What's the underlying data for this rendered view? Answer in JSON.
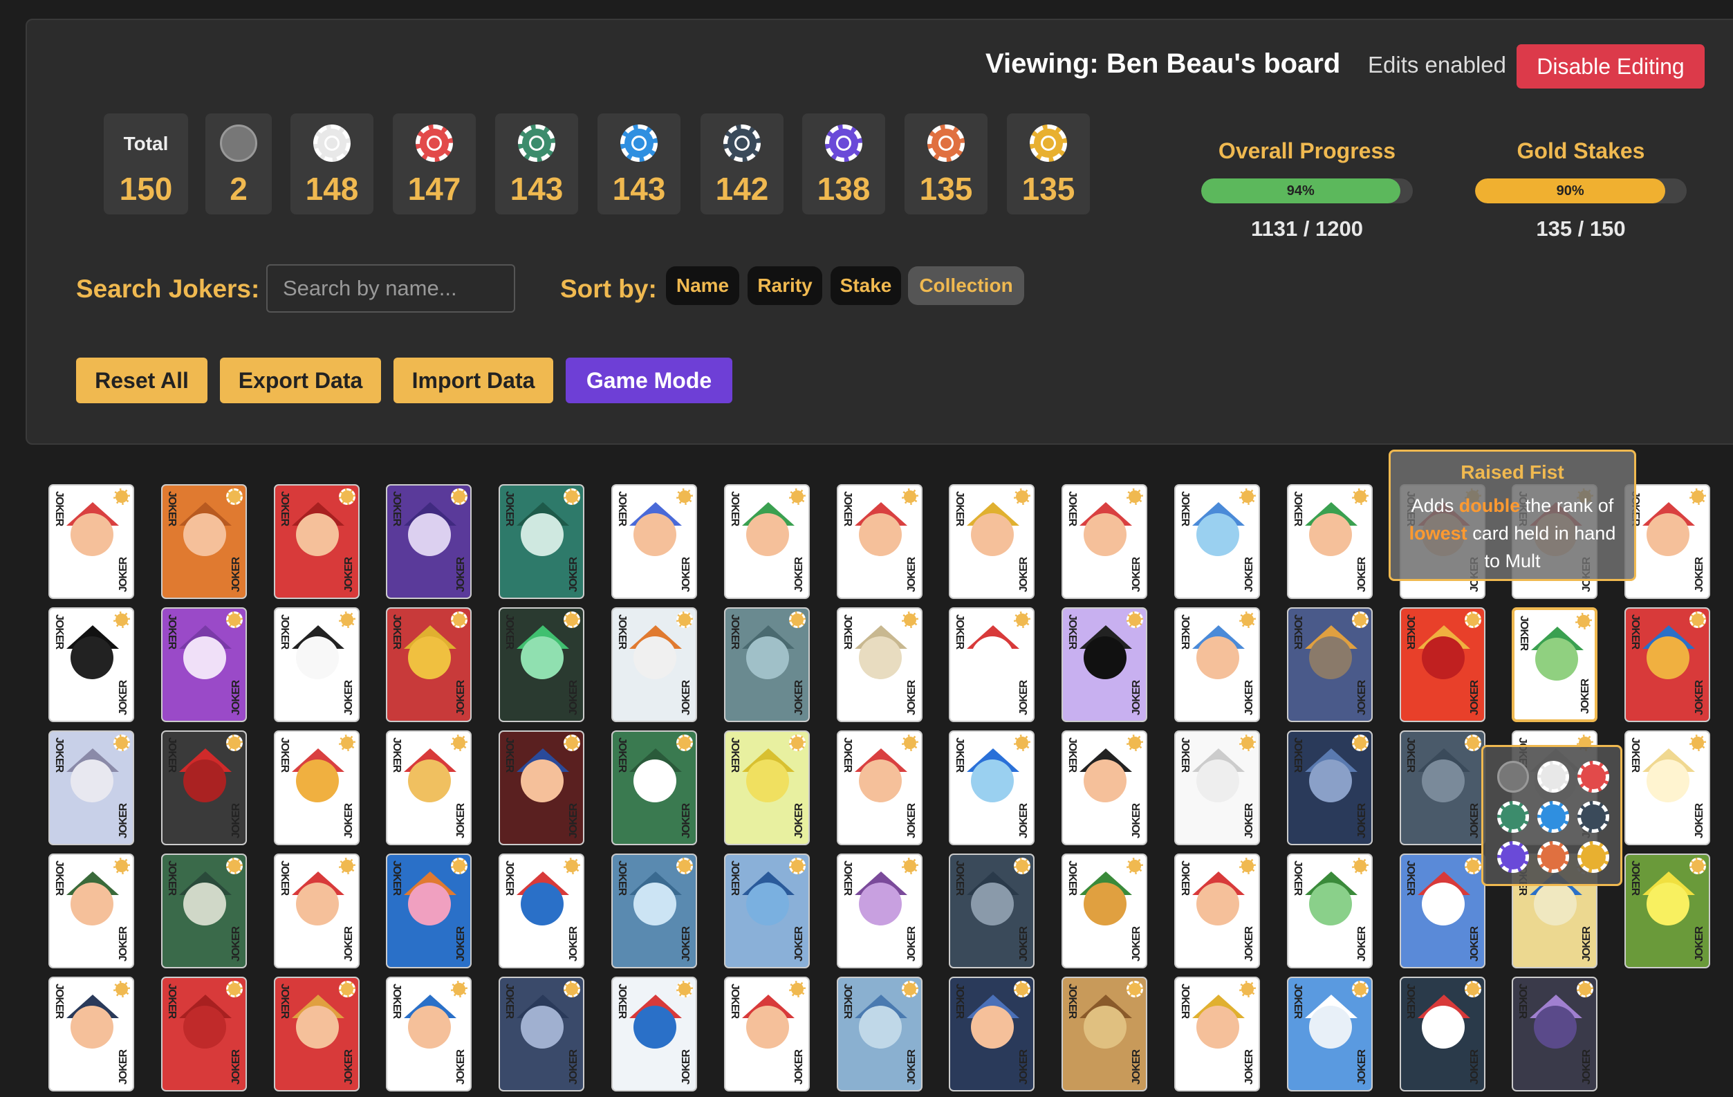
{
  "header": {
    "viewing": "Viewing: Ben Beau's board",
    "edits_status": "Edits enabled",
    "disable_button": "Disable Editing"
  },
  "stats": {
    "total_label": "Total",
    "total_value": "150",
    "stakes": [
      {
        "name": "no-stake-icon",
        "color": "#777777",
        "value": "2"
      },
      {
        "name": "white-stake-icon",
        "color": "#e8e8e8",
        "value": "148"
      },
      {
        "name": "red-stake-icon",
        "color": "#e24a4a",
        "value": "147"
      },
      {
        "name": "green-stake-icon",
        "color": "#3c8c6c",
        "value": "143"
      },
      {
        "name": "blue-stake-icon",
        "color": "#2f8fe0",
        "value": "143"
      },
      {
        "name": "black-stake-icon",
        "color": "#3a4a5a",
        "value": "142"
      },
      {
        "name": "purple-stake-icon",
        "color": "#6a4ad8",
        "value": "138"
      },
      {
        "name": "orange-stake-icon",
        "color": "#e07040",
        "value": "135"
      },
      {
        "name": "gold-stake-icon",
        "color": "#e8b030",
        "value": "135"
      }
    ]
  },
  "progress": {
    "overall_title": "Overall Progress",
    "overall_percent_label": "94%",
    "overall_fraction": 0.94,
    "overall_count": "1131 / 1200",
    "gold_title": "Gold Stakes",
    "gold_percent_label": "90%",
    "gold_fraction": 0.9,
    "gold_count": "135 / 150"
  },
  "search": {
    "label": "Search Jokers:",
    "placeholder": "Search by name..."
  },
  "sort": {
    "label": "Sort by:",
    "options": [
      "Name",
      "Rarity",
      "Stake",
      "Collection"
    ],
    "active": "Collection"
  },
  "actions": {
    "reset": "Reset All",
    "export": "Export Data",
    "import": "Import Data",
    "game_mode": "Game Mode"
  },
  "card_text": {
    "joker_word": "JOKER"
  },
  "tooltip": {
    "title": "Raised Fist",
    "desc_1": "Adds ",
    "hl_1": "double",
    "desc_2": " the rank of ",
    "hl_2": "lowest",
    "desc_3": " card held in hand to Mult"
  },
  "cards": [
    {
      "bg": "#ffffff",
      "hat": "#d94040",
      "face": "#f5c09a"
    },
    {
      "bg": "#e07a30",
      "hat": "#b85a20",
      "face": "#f5c09a"
    },
    {
      "bg": "#d83a3a",
      "hat": "#a82020",
      "face": "#f5c09a"
    },
    {
      "bg": "#5a3a9a",
      "hat": "#402a80",
      "face": "#dcd0f0"
    },
    {
      "bg": "#2e7a6a",
      "hat": "#1e5a4a",
      "face": "#cfe8e0"
    },
    {
      "bg": "#ffffff",
      "hat": "#4a6ad8",
      "face": "#f5c09a"
    },
    {
      "bg": "#ffffff",
      "hat": "#3aa050",
      "face": "#f5c09a"
    },
    {
      "bg": "#ffffff",
      "hat": "#d94040",
      "face": "#f5c09a"
    },
    {
      "bg": "#ffffff",
      "hat": "#e0b030",
      "face": "#f5c09a"
    },
    {
      "bg": "#ffffff",
      "hat": "#d94040",
      "face": "#f5c09a"
    },
    {
      "bg": "#ffffff",
      "hat": "#4a8ad8",
      "face": "#9ad0f0"
    },
    {
      "bg": "#ffffff",
      "hat": "#3aa050",
      "face": "#f5c09a"
    },
    {
      "bg": "#ffffff",
      "hat": "#d94040",
      "face": "#f5c09a"
    },
    {
      "bg": "#ffffff",
      "hat": "#d94040",
      "face": "#f5c09a"
    },
    {
      "bg": "#ffffff",
      "hat": "#d94040",
      "face": "#f5c09a"
    },
    {
      "bg": "#ffffff",
      "hat": "#111111",
      "face": "#222222"
    },
    {
      "bg": "#9a4ac8",
      "hat": "#7a3aa8",
      "face": "#f0e0f8"
    },
    {
      "bg": "#ffffff",
      "hat": "#222222",
      "face": "#f8f8f8"
    },
    {
      "bg": "#c83a3a",
      "hat": "#e0b030",
      "face": "#f0c040"
    },
    {
      "bg": "#2a3a30",
      "hat": "#40c070",
      "face": "#90e0b0"
    },
    {
      "bg": "#e8eef2",
      "hat": "#e07a30",
      "face": "#f0f0f0"
    },
    {
      "bg": "#6a8a90",
      "hat": "#4a6a70",
      "face": "#a0c0c8"
    },
    {
      "bg": "#ffffff",
      "hat": "#c8b890",
      "face": "#e8dcc0"
    },
    {
      "bg": "#ffffff",
      "hat": "#d83a3a",
      "face": "#ffffff"
    },
    {
      "bg": "#c8b0f0",
      "hat": "#222222",
      "face": "#111111"
    },
    {
      "bg": "#ffffff",
      "hat": "#4a8ad8",
      "face": "#f5c09a"
    },
    {
      "bg": "#4a5a8a",
      "hat": "#e0a040",
      "face": "#8a7a6a"
    },
    {
      "bg": "#e8402a",
      "hat": "#f0b040",
      "face": "#c02020"
    },
    {
      "bg": "#ffffff",
      "hat": "#3aa050",
      "face": "#90d080"
    },
    {
      "bg": "#d83a3a",
      "hat": "#2a70c8",
      "face": "#f0b040"
    },
    {
      "bg": "#c8d0e8",
      "hat": "#8a8aa8",
      "face": "#e8e8f0"
    },
    {
      "bg": "#3a3a3a",
      "hat": "#d02a2a",
      "face": "#aa2222"
    },
    {
      "bg": "#ffffff",
      "hat": "#d94040",
      "face": "#f0b040"
    },
    {
      "bg": "#ffffff",
      "hat": "#d83a3a",
      "face": "#f0c060"
    },
    {
      "bg": "#5a2020",
      "hat": "#2a4a9a",
      "face": "#f5c09a"
    },
    {
      "bg": "#3a7a50",
      "hat": "#2a5a3a",
      "face": "#ffffff"
    },
    {
      "bg": "#e8f0a0",
      "hat": "#d8c030",
      "face": "#f0e060"
    },
    {
      "bg": "#ffffff",
      "hat": "#d94040",
      "face": "#f5c09a"
    },
    {
      "bg": "#ffffff",
      "hat": "#2a70d8",
      "face": "#9ad0f0"
    },
    {
      "bg": "#ffffff",
      "hat": "#222222",
      "face": "#f5c09a"
    },
    {
      "bg": "#f8f8f8",
      "hat": "#cccccc",
      "face": "#eeeeee"
    },
    {
      "bg": "#2a3a5a",
      "hat": "#5a7ab0",
      "face": "#8aa0c8"
    },
    {
      "bg": "#4a5a6a",
      "hat": "#3a4a5a",
      "face": "#7a8a9a"
    },
    {
      "bg": "#ffffff",
      "hat": "#cccccc",
      "face": "#e8e8e8"
    },
    {
      "bg": "#ffffff",
      "hat": "#f0d890",
      "face": "#fff4d0"
    },
    {
      "bg": "#ffffff",
      "hat": "#3a6a3a",
      "face": "#f5c09a"
    },
    {
      "bg": "#3a6a4a",
      "hat": "#2a4a3a",
      "face": "#d0d8c8"
    },
    {
      "bg": "#ffffff",
      "hat": "#d83a3a",
      "face": "#f5c09a"
    },
    {
      "bg": "#2a70c8",
      "hat": "#e07a30",
      "face": "#f0a0c0"
    },
    {
      "bg": "#ffffff",
      "hat": "#d83a3a",
      "face": "#2a70c8"
    },
    {
      "bg": "#5a8ab0",
      "hat": "#3a6a90",
      "face": "#cce4f4"
    },
    {
      "bg": "#8ab0d8",
      "hat": "#2a5a9a",
      "face": "#7ab0e0"
    },
    {
      "bg": "#ffffff",
      "hat": "#7a4a9a",
      "face": "#c8a0e0"
    },
    {
      "bg": "#3a4a5a",
      "hat": "#2a3a4a",
      "face": "#8a9aaa"
    },
    {
      "bg": "#ffffff",
      "hat": "#3a8a3a",
      "face": "#e0a040"
    },
    {
      "bg": "#ffffff",
      "hat": "#d83a3a",
      "face": "#f5c09a"
    },
    {
      "bg": "#ffffff",
      "hat": "#3a8a3a",
      "face": "#8ad08a"
    },
    {
      "bg": "#5a8ad8",
      "hat": "#d83a3a",
      "face": "#ffffff"
    },
    {
      "bg": "#ecd890",
      "hat": "#2a70c8",
      "face": "#f0e8c0"
    },
    {
      "bg": "#6a9a3a",
      "hat": "#f0e040",
      "face": "#f8f060"
    },
    {
      "bg": "#ffffff",
      "hat": "#2a3a5a",
      "face": "#f5c09a"
    },
    {
      "bg": "#d83a3a",
      "hat": "#a82020",
      "face": "#c02a2a"
    },
    {
      "bg": "#d83a3a",
      "hat": "#e0a040",
      "face": "#f5c09a"
    },
    {
      "bg": "#ffffff",
      "hat": "#2a70c8",
      "face": "#f5c09a"
    },
    {
      "bg": "#3a4a6a",
      "hat": "#2a3a5a",
      "face": "#a0b0d0"
    },
    {
      "bg": "#f0f4f8",
      "hat": "#d83a3a",
      "face": "#2a70c8"
    },
    {
      "bg": "#ffffff",
      "hat": "#d83a3a",
      "face": "#f5c09a"
    },
    {
      "bg": "#8ab0d0",
      "hat": "#4a7ab0",
      "face": "#c0d8e8"
    },
    {
      "bg": "#2a3a5a",
      "hat": "#4a70b8",
      "face": "#f5c09a"
    },
    {
      "bg": "#c89a5a",
      "hat": "#8a5a2a",
      "face": "#e0c080"
    },
    {
      "bg": "#ffffff",
      "hat": "#e0b030",
      "face": "#f5c09a"
    },
    {
      "bg": "#5a9ae0",
      "hat": "#ffffff",
      "face": "#e8f0f8"
    },
    {
      "bg": "#2a3a4a",
      "hat": "#d83a3a",
      "face": "#ffffff"
    },
    {
      "bg": "#3a3a4a",
      "hat": "#a080d0",
      "face": "#5a4a8a"
    }
  ]
}
